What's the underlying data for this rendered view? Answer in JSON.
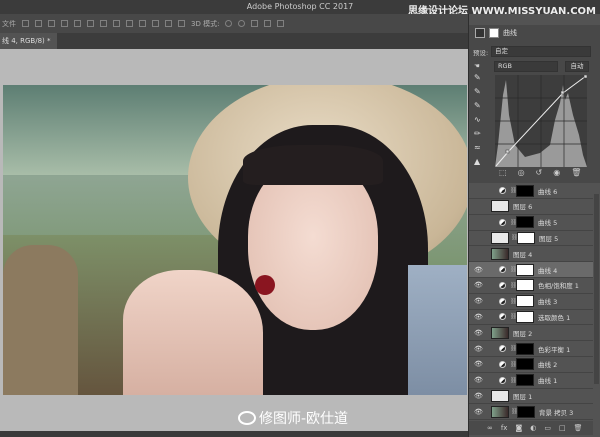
{
  "app": {
    "title": "Adobe Photoshop CC 2017",
    "watermark_top": "思缘设计论坛 WWW.MISSYUAN.COM"
  },
  "options": {
    "label": "文件",
    "mode3d": "3D 模式:"
  },
  "document_tab": "线 4, RGB/8) *",
  "canvas_watermark": "修图师-欧仕道",
  "properties": {
    "title": "曲线",
    "preset_label": "预设:",
    "preset_value": "自定",
    "channel": "RGB",
    "auto_button": "自动"
  },
  "layers": [
    {
      "name": "曲线 6",
      "visible": false,
      "type": "adjust",
      "mask": "black"
    },
    {
      "name": "图层 6",
      "visible": false,
      "type": "pixel"
    },
    {
      "name": "曲线 5",
      "visible": false,
      "type": "adjust",
      "mask": "black"
    },
    {
      "name": "图层 5",
      "visible": false,
      "type": "pixel",
      "mask": "white"
    },
    {
      "name": "图层 4",
      "visible": false,
      "type": "photo"
    },
    {
      "name": "曲线 4",
      "visible": true,
      "type": "adjust",
      "mask": "white",
      "selected": true
    },
    {
      "name": "色相/饱和度 1",
      "visible": true,
      "type": "adjust",
      "mask": "white"
    },
    {
      "name": "曲线 3",
      "visible": true,
      "type": "adjust",
      "mask": "white"
    },
    {
      "name": "选取颜色 1",
      "visible": true,
      "type": "adjust",
      "mask": "white"
    },
    {
      "name": "图层 2",
      "visible": true,
      "type": "photo"
    },
    {
      "name": "色彩平衡 1",
      "visible": true,
      "type": "adjust",
      "mask": "black"
    },
    {
      "name": "曲线 2",
      "visible": true,
      "type": "adjust",
      "mask": "black"
    },
    {
      "name": "曲线 1",
      "visible": true,
      "type": "adjust",
      "mask": "black"
    },
    {
      "name": "图层 1",
      "visible": true,
      "type": "pixel"
    },
    {
      "name": "背景 拷贝 3",
      "visible": true,
      "type": "photo",
      "mask": "black"
    }
  ]
}
